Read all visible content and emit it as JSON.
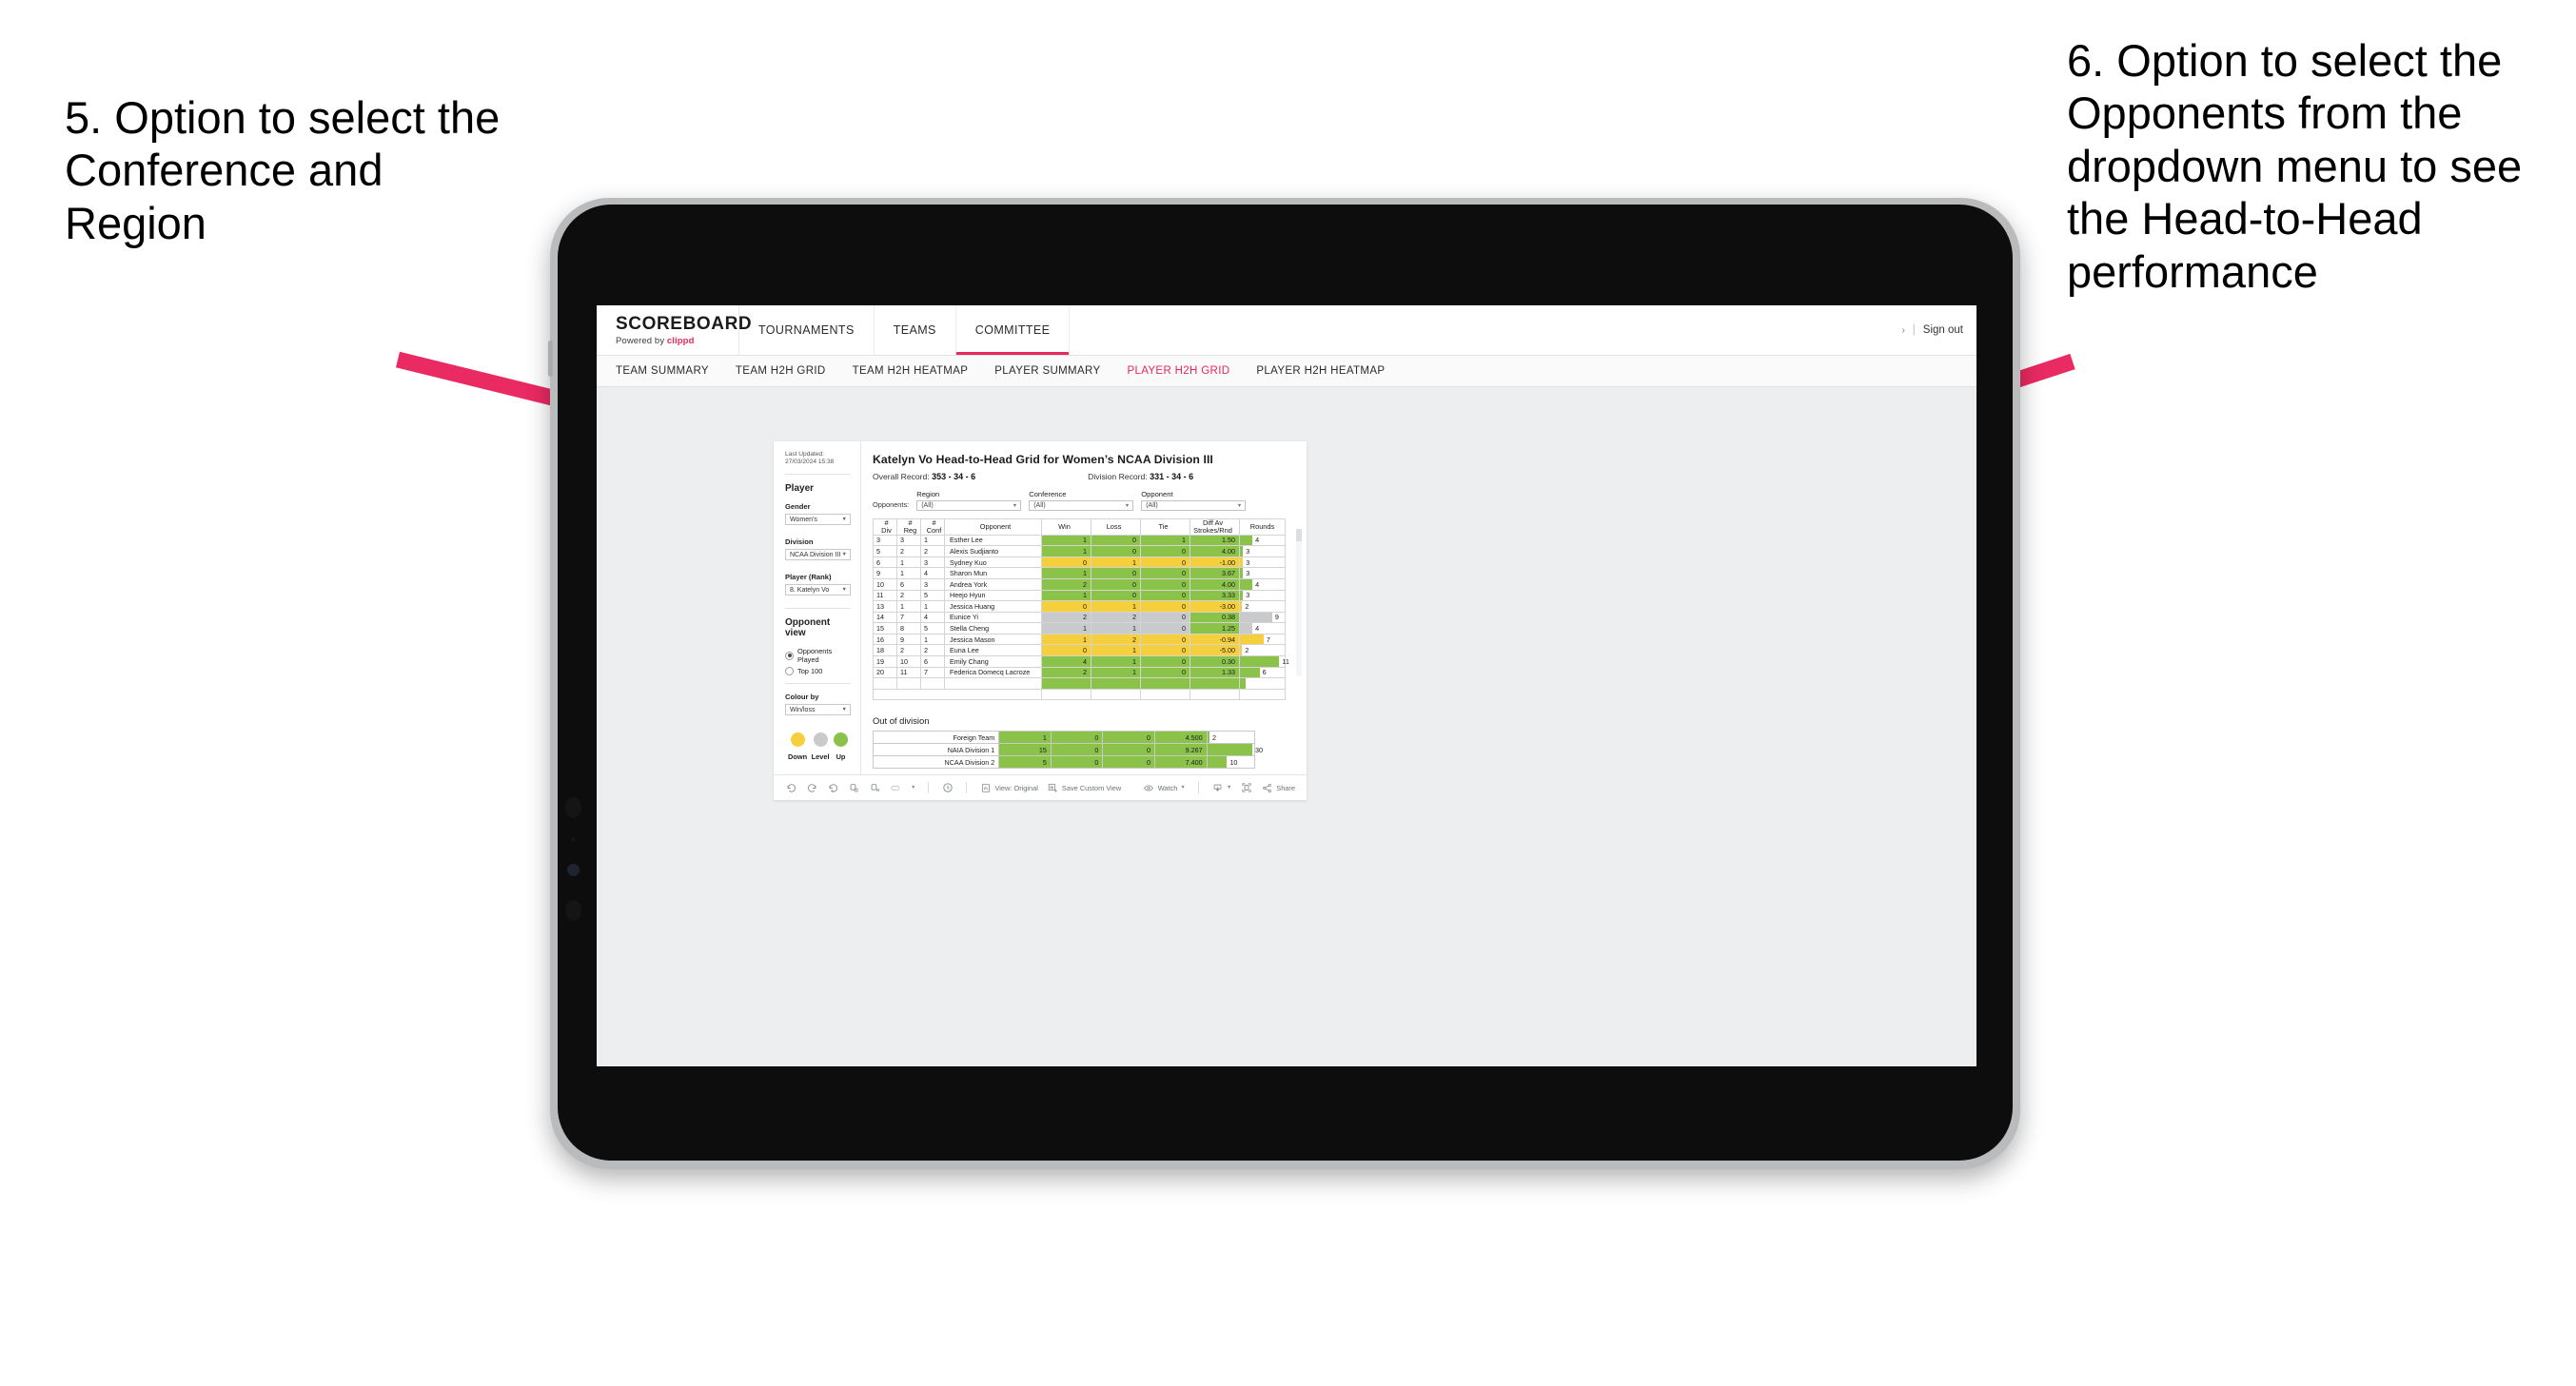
{
  "annotations": {
    "left": "5. Option to select the Conference and Region",
    "right": "6. Option to select the Opponents from the dropdown menu to see the Head-to-Head performance",
    "arrow_color": "#ea2a62"
  },
  "app": {
    "brand": {
      "name": "SCOREBOARD",
      "powered_prefix": "Powered by ",
      "powered_brand": "clippd"
    },
    "topnav": [
      {
        "label": "TOURNAMENTS",
        "active": false
      },
      {
        "label": "TEAMS",
        "active": false
      },
      {
        "label": "COMMITTEE",
        "active": true
      }
    ],
    "header_right": {
      "chevron": "›",
      "separator": "|",
      "signout": "Sign out"
    },
    "subnav": [
      {
        "label": "TEAM SUMMARY",
        "active": false
      },
      {
        "label": "TEAM H2H GRID",
        "active": false
      },
      {
        "label": "TEAM H2H HEATMAP",
        "active": false
      },
      {
        "label": "PLAYER SUMMARY",
        "active": false
      },
      {
        "label": "PLAYER H2H GRID",
        "active": true
      },
      {
        "label": "PLAYER H2H HEATMAP",
        "active": false
      }
    ],
    "accent_color": "#e8275a"
  },
  "sidebar": {
    "last_updated": "Last Updated: 27/03/2024 15:38",
    "section_player": "Player",
    "gender": {
      "label": "Gender",
      "value": "Women’s"
    },
    "division": {
      "label": "Division",
      "value": "NCAA Division III"
    },
    "player_rank": {
      "label": "Player (Rank)",
      "value": "8. Katelyn Vo"
    },
    "opponent_view": {
      "label": "Opponent view",
      "options": [
        {
          "label": "Opponents Played",
          "selected": true
        },
        {
          "label": "Top 100",
          "selected": false
        }
      ]
    },
    "colour_by": {
      "label": "Colour by",
      "value": "Win/loss"
    },
    "legend": [
      {
        "label": "Down",
        "color": "#f5d03c"
      },
      {
        "label": "Level",
        "color": "#c8cacc"
      },
      {
        "label": "Up",
        "color": "#8bc34a"
      }
    ]
  },
  "main": {
    "title": "Katelyn Vo Head-to-Head Grid for Women’s NCAA Division III",
    "overall_record_label": "Overall Record:",
    "overall_record_value": "353 - 34 - 6",
    "division_record_label": "Division Record:",
    "division_record_value": "331 - 34 - 6",
    "opponents_label": "Opponents:",
    "filters": [
      {
        "name": "Region",
        "value": "(All)"
      },
      {
        "name": "Conference",
        "value": "(All)"
      },
      {
        "name": "Opponent",
        "value": "(All)"
      }
    ]
  },
  "chart_data": {
    "type": "table",
    "title": "Katelyn Vo Head-to-Head Grid for Women’s NCAA Division III",
    "columns": [
      "# Div",
      "# Reg",
      "# Conf",
      "Opponent",
      "Win",
      "Loss",
      "Tie",
      "Diff Av Strokes/Rnd",
      "Rounds"
    ],
    "column_headers_multiline": [
      [
        "#",
        "Div"
      ],
      [
        "#",
        "Reg"
      ],
      [
        "#",
        "Conf"
      ],
      [
        "Opponent"
      ],
      [
        "Win"
      ],
      [
        "Loss"
      ],
      [
        "Tie"
      ],
      [
        "Diff Av",
        "Strokes/Rnd"
      ],
      [
        "Rounds"
      ]
    ],
    "rows": [
      {
        "div": "3",
        "reg": "3",
        "conf": "1",
        "opponent": "Esther Lee",
        "win": "1",
        "loss": "0",
        "tie": "1",
        "diff": "1.50",
        "rounds": "4",
        "rounds_pct": 28,
        "color": "#8bc34a"
      },
      {
        "div": "5",
        "reg": "2",
        "conf": "2",
        "opponent": "Alexis Sudjianto",
        "win": "1",
        "loss": "0",
        "tie": "0",
        "diff": "4.00",
        "rounds": "3",
        "rounds_pct": 7,
        "color": "#8bc34a"
      },
      {
        "div": "6",
        "reg": "1",
        "conf": "3",
        "opponent": "Sydney Kuo",
        "win": "0",
        "loss": "1",
        "tie": "0",
        "diff": "-1.00",
        "rounds": "3",
        "rounds_pct": 7,
        "color": "#f5d03c"
      },
      {
        "div": "9",
        "reg": "1",
        "conf": "4",
        "opponent": "Sharon Mun",
        "win": "1",
        "loss": "0",
        "tie": "0",
        "diff": "3.67",
        "rounds": "3",
        "rounds_pct": 7,
        "color": "#8bc34a"
      },
      {
        "div": "10",
        "reg": "6",
        "conf": "3",
        "opponent": "Andrea York",
        "win": "2",
        "loss": "0",
        "tie": "0",
        "diff": "4.00",
        "rounds": "4",
        "rounds_pct": 28,
        "color": "#8bc34a"
      },
      {
        "div": "11",
        "reg": "2",
        "conf": "5",
        "opponent": "Heejo Hyun",
        "win": "1",
        "loss": "0",
        "tie": "0",
        "diff": "3.33",
        "rounds": "3",
        "rounds_pct": 7,
        "color": "#8bc34a"
      },
      {
        "div": "13",
        "reg": "1",
        "conf": "1",
        "opponent": "Jessica Huang",
        "win": "0",
        "loss": "1",
        "tie": "0",
        "diff": "-3.00",
        "rounds": "2",
        "rounds_pct": 5,
        "color": "#f5d03c"
      },
      {
        "div": "14",
        "reg": "7",
        "conf": "4",
        "opponent": "Eunice Yi",
        "win": "2",
        "loss": "2",
        "tie": "0",
        "diff": "0.38",
        "rounds": "9",
        "rounds_pct": 72,
        "color": "#c8cacc",
        "diff_color": "#8bc34a"
      },
      {
        "div": "15",
        "reg": "8",
        "conf": "5",
        "opponent": "Stella Cheng",
        "win": "1",
        "loss": "1",
        "tie": "0",
        "diff": "1.25",
        "rounds": "4",
        "rounds_pct": 28,
        "color": "#c8cacc",
        "diff_color": "#8bc34a"
      },
      {
        "div": "16",
        "reg": "9",
        "conf": "1",
        "opponent": "Jessica Mason",
        "win": "1",
        "loss": "2",
        "tie": "0",
        "diff": "-0.94",
        "rounds": "7",
        "rounds_pct": 53,
        "color": "#f5d03c"
      },
      {
        "div": "18",
        "reg": "2",
        "conf": "2",
        "opponent": "Euna Lee",
        "win": "0",
        "loss": "1",
        "tie": "0",
        "diff": "-5.00",
        "rounds": "2",
        "rounds_pct": 5,
        "color": "#f5d03c"
      },
      {
        "div": "19",
        "reg": "10",
        "conf": "6",
        "opponent": "Emily Chang",
        "win": "4",
        "loss": "1",
        "tie": "0",
        "diff": "0.30",
        "rounds": "11",
        "rounds_pct": 88,
        "color": "#8bc34a"
      },
      {
        "div": "20",
        "reg": "11",
        "conf": "7",
        "opponent": "Federica Domecq Lacroze",
        "win": "2",
        "loss": "1",
        "tie": "0",
        "diff": "1.33",
        "rounds": "6",
        "rounds_pct": 44,
        "color": "#8bc34a"
      }
    ],
    "out_of_division": {
      "title": "Out of division",
      "rows": [
        {
          "name": "Foreign Team",
          "win": "1",
          "loss": "0",
          "tie": "0",
          "diff": "4.500",
          "rounds": "2",
          "rounds_pct": 5,
          "color": "#8bc34a"
        },
        {
          "name": "NAIA Division 1",
          "win": "15",
          "loss": "0",
          "tie": "0",
          "diff": "9.267",
          "rounds": "30",
          "rounds_pct": 96,
          "color": "#8bc34a"
        },
        {
          "name": "NCAA Division 2",
          "win": "5",
          "loss": "0",
          "tie": "0",
          "diff": "7.400",
          "rounds": "10",
          "rounds_pct": 42,
          "color": "#8bc34a"
        }
      ]
    }
  },
  "toolbar": {
    "left_icons": [
      "undo-icon",
      "redo-icon",
      "revert-icon",
      "refresh-icon",
      "pause-icon",
      "shape-icon",
      "dropdown-caret-icon",
      "clock-icon"
    ],
    "view_original": "View: Original",
    "save_custom_view": "Save Custom View",
    "watch": "Watch",
    "share": "Share",
    "icons": {
      "view": "view-icon",
      "save": "save-view-icon",
      "watch": "eye-icon",
      "download": "download-icon",
      "fullscreen": "fullscreen-icon",
      "share": "share-icon"
    }
  }
}
